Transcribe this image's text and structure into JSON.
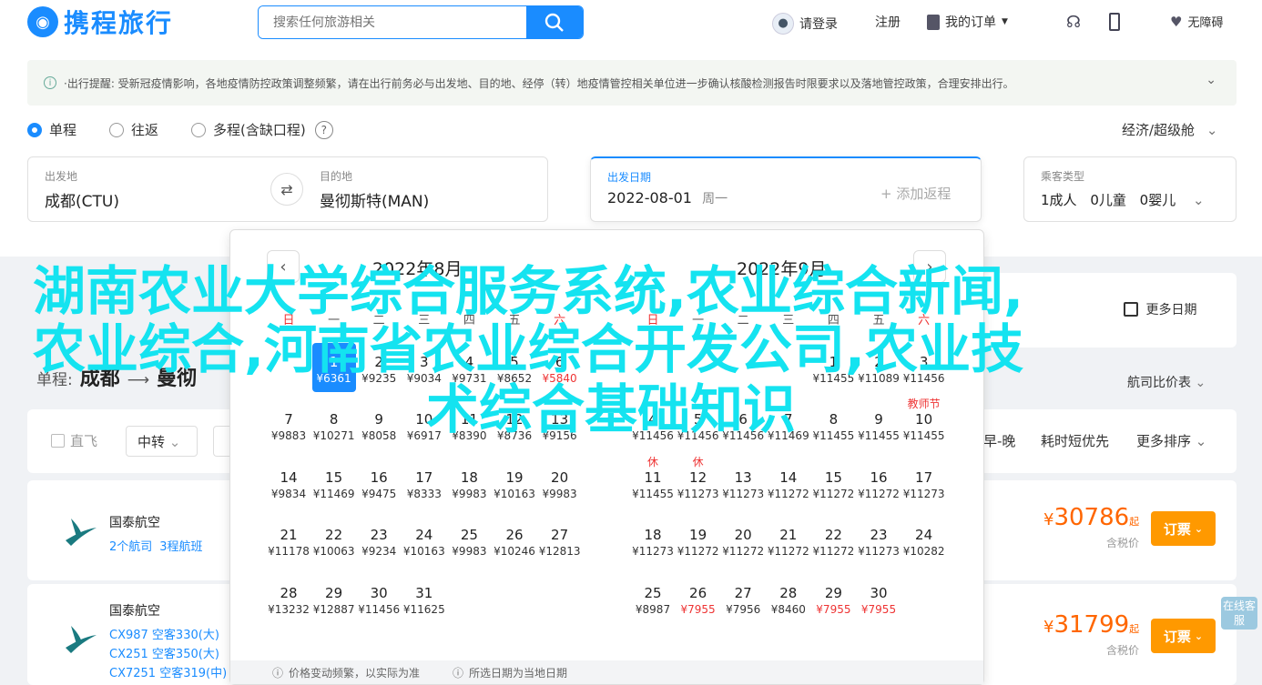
{
  "header": {
    "logo_text": "携程旅行",
    "search_placeholder": "搜索任何旅游相关",
    "login": "请登录",
    "register": "注册",
    "orders": "我的订单",
    "accessibility": "无障碍"
  },
  "notice": "·出行提醒: 受新冠疫情影响，各地疫情防控政策调整频繁，请在出行前务必与出发地、目的地、经停（转）地疫情管控相关单位进一步确认核酸检测报告时限要求以及落地管控政策，合理安排出行。",
  "trip_type": {
    "options": [
      "单程",
      "往返",
      "多程(含缺口程)"
    ],
    "selected": "单程",
    "cabin": "经济/超级舱"
  },
  "search_form": {
    "from_label": "出发地",
    "from_value": "成都(CTU)",
    "to_label": "目的地",
    "to_value": "曼彻斯特(MAN)",
    "date_label": "出发日期",
    "date_value": "2022-08-01",
    "weekday": "周一",
    "add_return": "+ 添加返程",
    "pax_label": "乘客类型",
    "pax_adult": "1成人",
    "pax_child": "0儿童",
    "pax_infant": "0婴儿"
  },
  "results": {
    "summary_prefix": "单程:",
    "from_city": "成都",
    "to_city": "曼彻",
    "more_dates": "更多日期",
    "compare": "航司比价表"
  },
  "filters": {
    "direct": "直飞",
    "transfer": "中转",
    "early_late": "早-晚",
    "shortest": "耗时短优先",
    "more_sort": "更多排序"
  },
  "flights": [
    {
      "airline": "国泰航空",
      "sub": [
        "2个航司",
        "3程航班"
      ],
      "price": "30786",
      "price_suffix": "起",
      "tax": "含税价",
      "book": "订票"
    },
    {
      "airline": "国泰航空",
      "sub": [
        "CX987 空客330(大)",
        "CX251 空客350(大)",
        "CX7251 空客319(中)"
      ],
      "price": "31799",
      "price_suffix": "起",
      "tax": "含税价",
      "book": "订票"
    }
  ],
  "online_service": "在线客服",
  "calendar": {
    "left_title": "2022年8月",
    "right_title": "2022年9月",
    "weekdays": [
      "日",
      "一",
      "二",
      "三",
      "四",
      "五",
      "六"
    ],
    "left_days": [
      {
        "d": "1",
        "p": "¥6361",
        "sel": true
      },
      {
        "d": "2",
        "p": "¥9235"
      },
      {
        "d": "3",
        "p": "¥9034"
      },
      {
        "d": "4",
        "p": "¥9731"
      },
      {
        "d": "5",
        "p": "¥8652"
      },
      {
        "d": "6",
        "p": "¥5840",
        "red": true
      },
      {
        "d": "7",
        "p": "¥9883"
      },
      {
        "d": "8",
        "p": "¥10271"
      },
      {
        "d": "9",
        "p": "¥8058"
      },
      {
        "d": "10",
        "p": "¥6917"
      },
      {
        "d": "11",
        "p": "¥8390"
      },
      {
        "d": "12",
        "p": "¥8736"
      },
      {
        "d": "13",
        "p": "¥9156"
      },
      {
        "d": "14",
        "p": "¥9834"
      },
      {
        "d": "15",
        "p": "¥11469"
      },
      {
        "d": "16",
        "p": "¥9475"
      },
      {
        "d": "17",
        "p": "¥8333"
      },
      {
        "d": "18",
        "p": "¥9983"
      },
      {
        "d": "19",
        "p": "¥10163"
      },
      {
        "d": "20",
        "p": "¥9983"
      },
      {
        "d": "21",
        "p": "¥11178"
      },
      {
        "d": "22",
        "p": "¥10063"
      },
      {
        "d": "23",
        "p": "¥9234"
      },
      {
        "d": "24",
        "p": "¥10163"
      },
      {
        "d": "25",
        "p": "¥9983"
      },
      {
        "d": "26",
        "p": "¥10246"
      },
      {
        "d": "27",
        "p": "¥12813"
      },
      {
        "d": "28",
        "p": "¥13232"
      },
      {
        "d": "29",
        "p": "¥12887"
      },
      {
        "d": "30",
        "p": "¥11456"
      },
      {
        "d": "31",
        "p": "¥11625"
      }
    ],
    "right_days": [
      {
        "d": "1",
        "p": "¥11455"
      },
      {
        "d": "2",
        "p": "¥11089"
      },
      {
        "d": "3",
        "p": "¥11456"
      },
      {
        "d": "4",
        "p": "¥11456"
      },
      {
        "d": "5",
        "p": "¥11456"
      },
      {
        "d": "6",
        "p": "¥11456"
      },
      {
        "d": "7",
        "p": "¥11469"
      },
      {
        "d": "8",
        "p": "¥11455"
      },
      {
        "d": "9",
        "p": "¥11455"
      },
      {
        "d": "10",
        "p": "¥11455",
        "tag": "教师节"
      },
      {
        "d": "11",
        "p": "¥11455",
        "tag": "休"
      },
      {
        "d": "12",
        "p": "¥11273",
        "tag": "休"
      },
      {
        "d": "13",
        "p": "¥11273"
      },
      {
        "d": "14",
        "p": "¥11272"
      },
      {
        "d": "15",
        "p": "¥11272"
      },
      {
        "d": "16",
        "p": "¥11272"
      },
      {
        "d": "17",
        "p": "¥11273"
      },
      {
        "d": "18",
        "p": "¥11273"
      },
      {
        "d": "19",
        "p": "¥11272"
      },
      {
        "d": "20",
        "p": "¥11272"
      },
      {
        "d": "21",
        "p": "¥11272"
      },
      {
        "d": "22",
        "p": "¥11272"
      },
      {
        "d": "23",
        "p": "¥11273"
      },
      {
        "d": "24",
        "p": "¥10282"
      },
      {
        "d": "25",
        "p": "¥8987"
      },
      {
        "d": "26",
        "p": "¥7955",
        "red": true
      },
      {
        "d": "27",
        "p": "¥7956"
      },
      {
        "d": "28",
        "p": "¥8460"
      },
      {
        "d": "29",
        "p": "¥7955",
        "red": true
      },
      {
        "d": "30",
        "p": "¥7955",
        "red": true
      }
    ],
    "footer_left": "价格变动频繁，以实际为准",
    "footer_right": "所选日期为当地日期"
  },
  "watermark": [
    "湖南农业大学综合服务系统,农业综合新闻,",
    "农业综合,河南省农业综合开发公司,农业技",
    "术综合基础知识"
  ]
}
